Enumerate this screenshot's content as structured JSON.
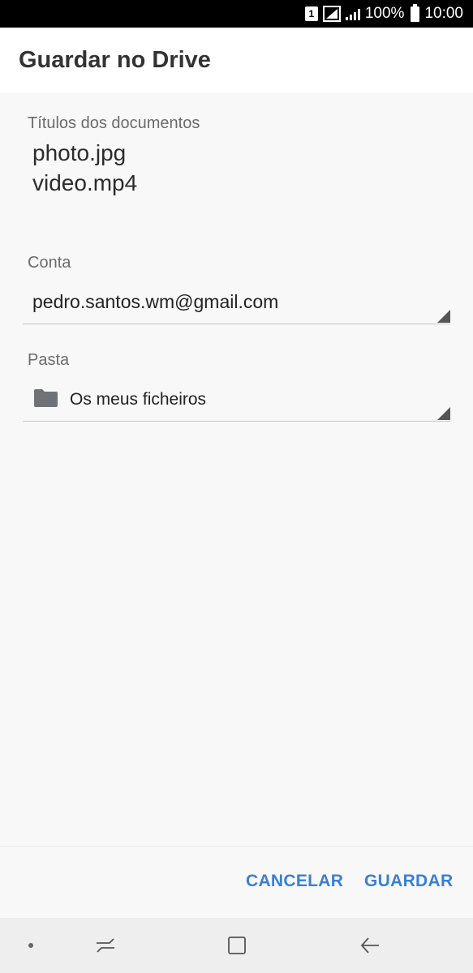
{
  "status_bar": {
    "sim": "1",
    "battery": "100%",
    "time": "10:00"
  },
  "header": {
    "title": "Guardar no Drive"
  },
  "documents": {
    "label": "Títulos dos documentos",
    "titles": [
      "photo.jpg",
      "video.mp4"
    ]
  },
  "account": {
    "label": "Conta",
    "value": "pedro.santos.wm@gmail.com"
  },
  "folder": {
    "label": "Pasta",
    "value": "Os meus ficheiros",
    "icon": "folder-icon"
  },
  "actions": {
    "cancel": "CANCELAR",
    "save": "GUARDAR",
    "accent_color": "#3a7fd5"
  },
  "nav": {
    "icons": [
      "recent-apps-icon",
      "home-icon",
      "back-icon"
    ]
  }
}
